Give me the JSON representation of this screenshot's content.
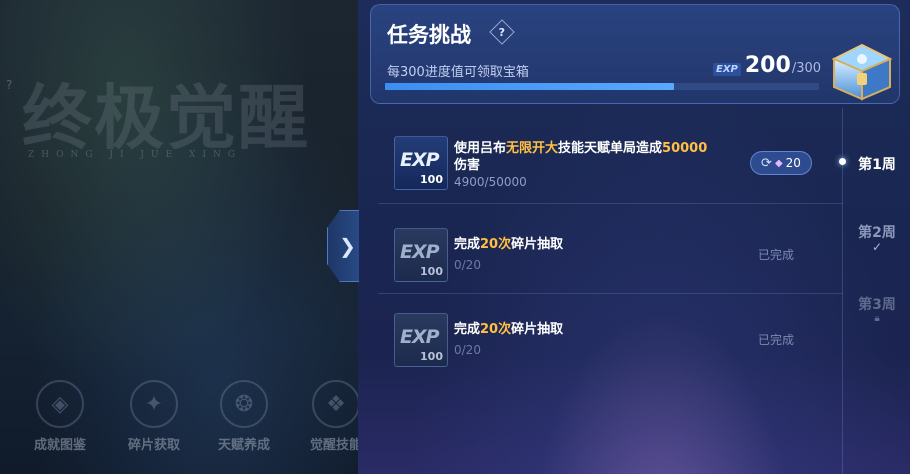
{
  "left_bg": {
    "title": "终极觉醒",
    "pinyin": "ZHONG JI JUE XING",
    "help": "?",
    "nav": [
      {
        "label": "成就图鉴",
        "icon": "achievement-emblem-icon",
        "glyph": "◈"
      },
      {
        "label": "碎片获取",
        "icon": "fragment-emblem-icon",
        "glyph": "✦"
      },
      {
        "label": "天赋养成",
        "icon": "talent-emblem-icon",
        "glyph": "❂"
      },
      {
        "label": "觉醒技能",
        "icon": "awaken-emblem-icon",
        "glyph": "❖"
      }
    ]
  },
  "collapse": {
    "glyph": "❯",
    "icon": "chevron-right-icon"
  },
  "header": {
    "title": "任务挑战",
    "help_glyph": "?",
    "subtitle": "每300进度值可领取宝箱",
    "exp_tag": "EXP",
    "score_current": "200",
    "score_total": "/300",
    "progress": 0.667
  },
  "tasks": [
    {
      "exp_label": "EXP",
      "exp_amount": "100",
      "desc_parts": [
        {
          "text": "使用吕布",
          "hl": false
        },
        {
          "text": "无限开大",
          "hl": true
        },
        {
          "text": "技能天赋单局造成",
          "hl": false
        },
        {
          "text": "50000",
          "hl": true
        },
        {
          "text": "伤害",
          "hl": false
        }
      ],
      "progress": "4900/50000",
      "reward_count": "20",
      "status": ""
    },
    {
      "exp_label": "EXP",
      "exp_amount": "100",
      "desc_parts": [
        {
          "text": "完成",
          "hl": false
        },
        {
          "text": "20次",
          "hl": true
        },
        {
          "text": "碎片抽取",
          "hl": false
        }
      ],
      "progress": "0/20",
      "reward_count": "",
      "status": "已完成"
    },
    {
      "exp_label": "EXP",
      "exp_amount": "100",
      "desc_parts": [
        {
          "text": "完成",
          "hl": false
        },
        {
          "text": "20次",
          "hl": true
        },
        {
          "text": "碎片抽取",
          "hl": false
        }
      ],
      "progress": "0/20",
      "reward_count": "",
      "status": "已完成"
    }
  ],
  "weeks": [
    {
      "label": "第1周",
      "state": "active"
    },
    {
      "label": "第2周",
      "state": "completed"
    },
    {
      "label": "第3周",
      "state": "locked"
    }
  ],
  "colors": {
    "highlight": "#ffc043",
    "accent": "#4a9bff",
    "panel": "#1c2a57"
  }
}
